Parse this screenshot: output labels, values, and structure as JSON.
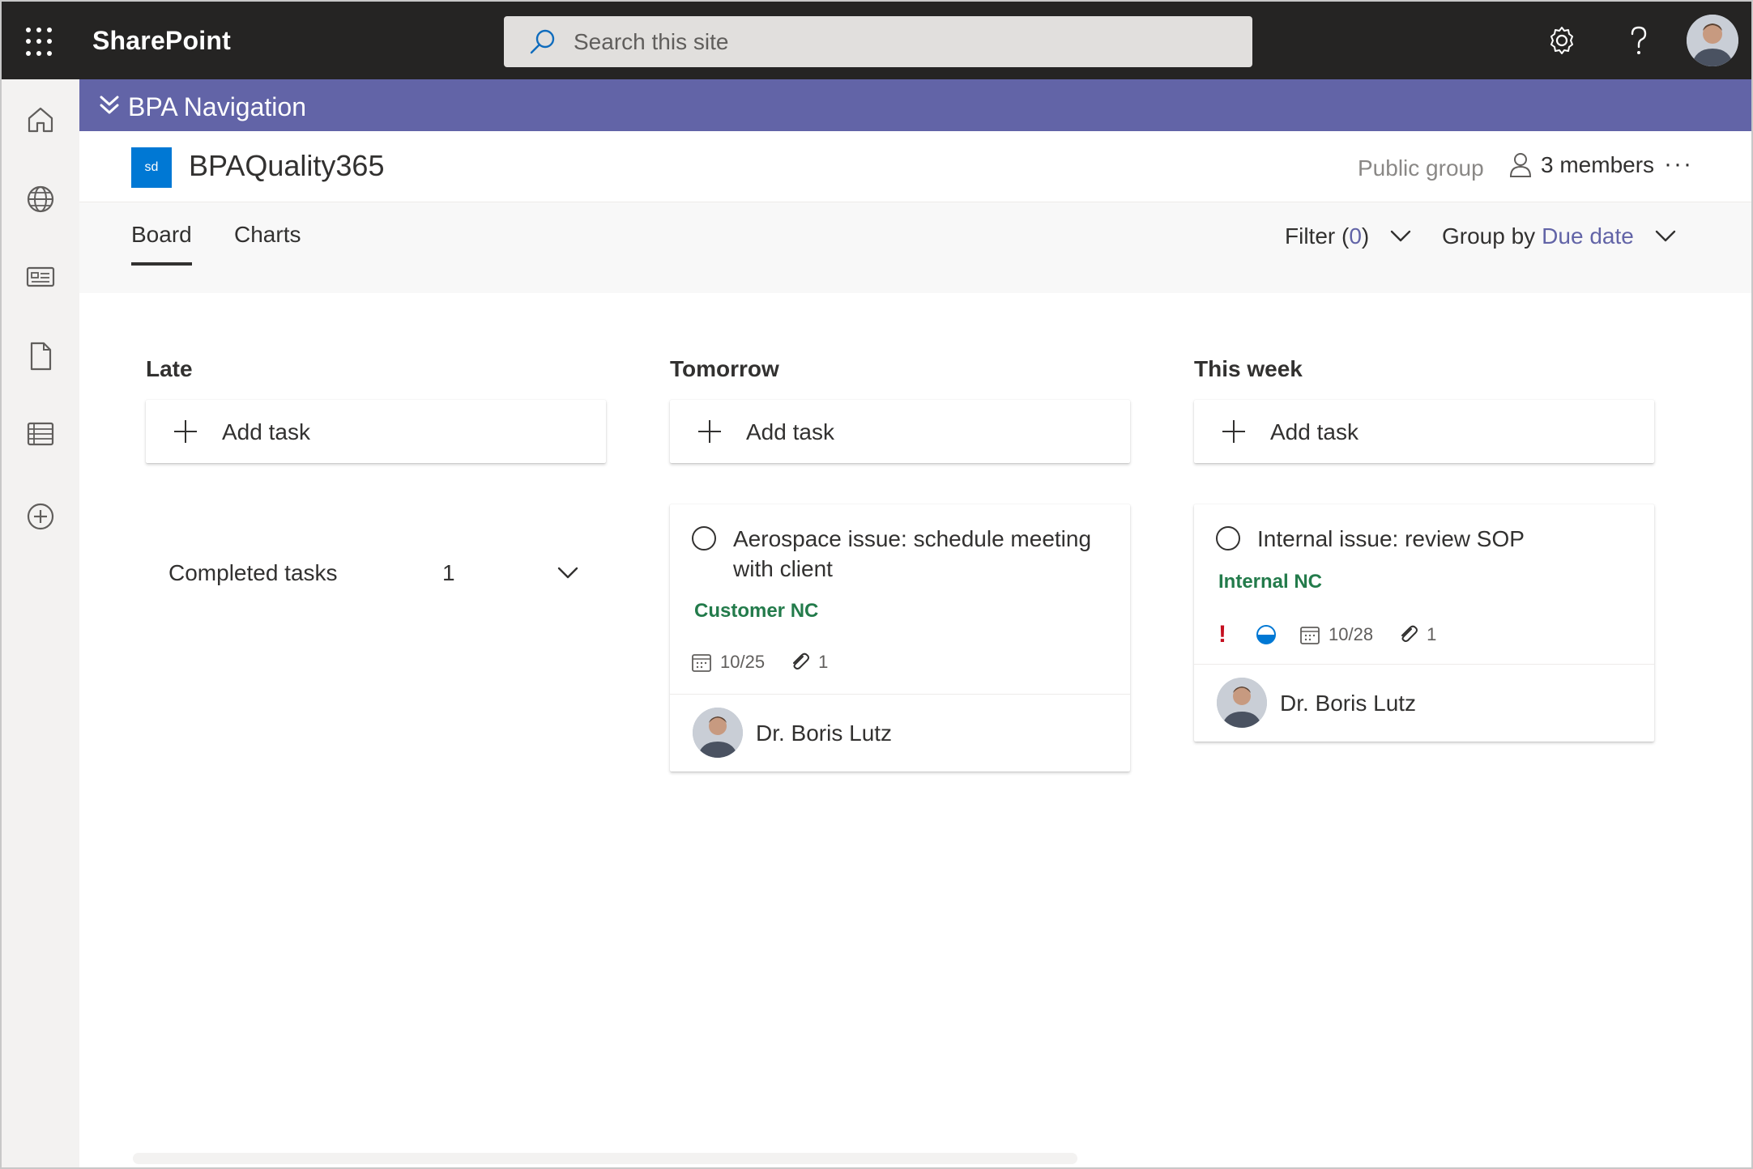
{
  "suitebar": {
    "brand": "SharePoint",
    "search_placeholder": "Search this site",
    "icons": [
      "waffle-icon",
      "search-icon",
      "settings-gear-icon",
      "help-icon",
      "avatar"
    ]
  },
  "hubnav": {
    "title": "BPA Navigation"
  },
  "site": {
    "logo_text": "sd",
    "title": "BPAQuality365",
    "privacy": "Public group",
    "members": "3 members",
    "more": "···"
  },
  "tabs": {
    "board": "Board",
    "charts": "Charts"
  },
  "toolbar": {
    "filter_prefix": "Filter (",
    "filter_count": "0",
    "filter_suffix": ")",
    "group_prefix": "Group by ",
    "group_value": "Due date"
  },
  "columns": [
    {
      "title": "Late",
      "add_label": "Add task"
    },
    {
      "title": "Tomorrow",
      "add_label": "Add task"
    },
    {
      "title": "This week",
      "add_label": "Add task"
    }
  ],
  "completed": {
    "label": "Completed tasks",
    "count": "1"
  },
  "tasks": [
    {
      "title": "Aerospace issue: schedule meeting with client",
      "label": "Customer NC",
      "due": "10/25",
      "attachments": "1",
      "assignee": "Dr. Boris Lutz"
    },
    {
      "title": "Internal issue: review SOP",
      "label": "Internal NC",
      "priority": "!",
      "due": "10/28",
      "attachments": "1",
      "assignee": "Dr. Boris Lutz"
    }
  ],
  "colors": {
    "suitebar": "#252423",
    "hubnav": "#6264a7",
    "accent": "#6264a7",
    "label_green": "#237b4b",
    "priority_red": "#c50f1f",
    "progress_blue": "#0078d4"
  }
}
